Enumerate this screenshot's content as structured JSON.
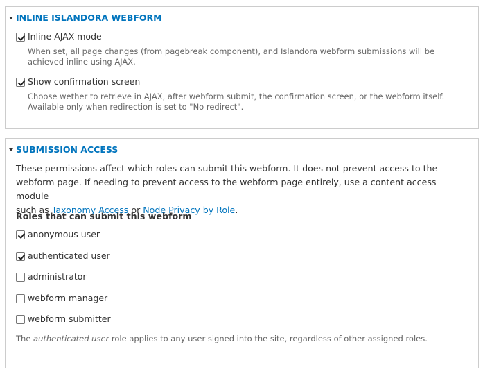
{
  "inline_webform": {
    "legend": "INLINE ISLANDORA WEBFORM",
    "options": [
      {
        "label": "Inline AJAX mode",
        "checked": true,
        "description_lines": [
          "When set, all page changes (from pagebreak component), and Islandora webform submissions will be",
          "achieved inline using AJAX."
        ]
      },
      {
        "label": "Show confirmation screen",
        "checked": true,
        "description_lines": [
          "Choose wether to retrieve in AJAX, after webform submit, the confirmation screen, or the webform itself.",
          "Available only when redirection is set to \"No redirect\"."
        ]
      }
    ]
  },
  "submission_access": {
    "legend": "SUBMISSION ACCESS",
    "intro_line1": "These permissions affect which roles can submit this webform. It does not prevent access to the",
    "intro_line2": "webform page. If needing to prevent access to the webform page entirely, use a content access module",
    "intro_line3_prefix": "such as ",
    "link_taxonomy": "Taxonomy Access",
    "intro_or": " or ",
    "link_node_privacy": "Node Privacy by Role",
    "intro_end": ".",
    "roles_heading": "Roles that can submit this webform",
    "roles": [
      {
        "label": "anonymous user",
        "checked": true
      },
      {
        "label": "authenticated user",
        "checked": true
      },
      {
        "label": "administrator",
        "checked": false
      },
      {
        "label": "webform manager",
        "checked": false
      },
      {
        "label": "webform submitter",
        "checked": false
      }
    ],
    "note_prefix": "The ",
    "note_emphasis": "authenticated user",
    "note_suffix": " role applies to any user signed into the site, regardless of other assigned roles."
  },
  "colors": {
    "link": "#0074bd",
    "border": "#cccccc",
    "description": "#666666",
    "text": "#333333"
  }
}
